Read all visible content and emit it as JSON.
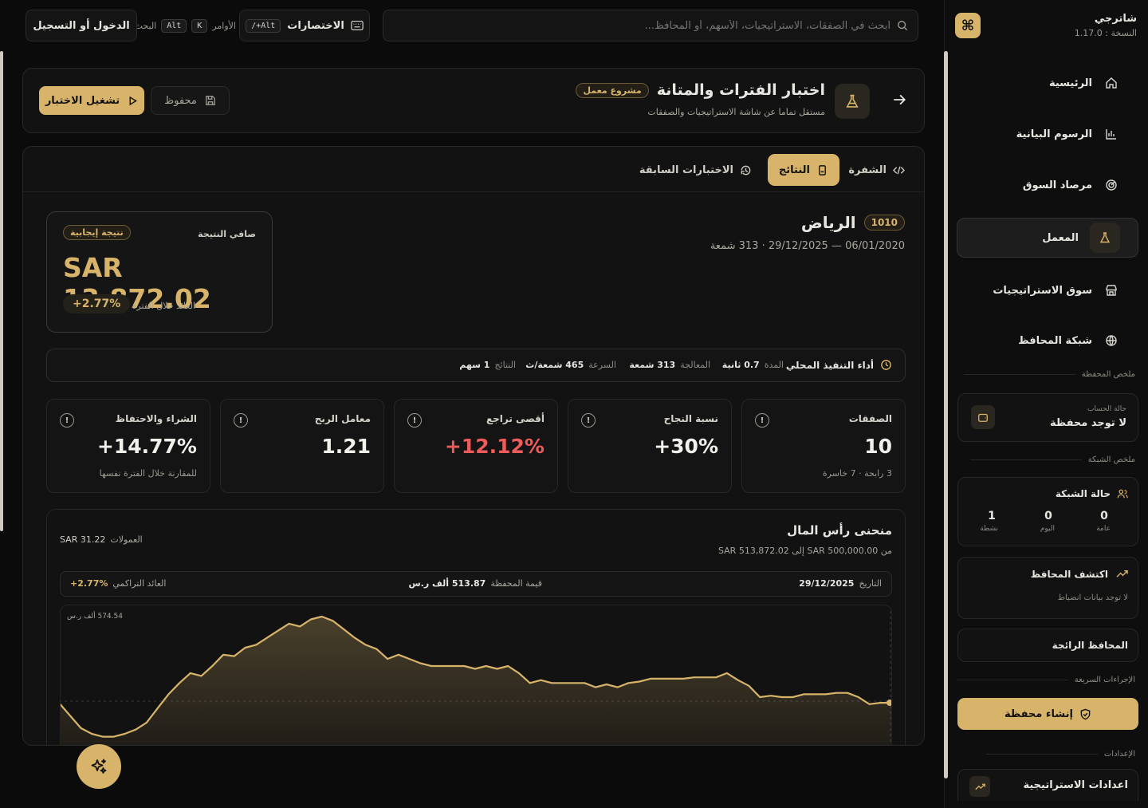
{
  "app": {
    "name": "شاترجي",
    "version": "النسخة : 1.17.0"
  },
  "header": {
    "search_placeholder": "ابحث في الصفقات، الاستراتيجيات، الأسهم، أو المحافظ...",
    "shortcuts_label": "الاختصارات",
    "shortcuts_key": "Alt+/",
    "commands_label": "الأوامر",
    "commands_key_1": "K",
    "commands_key_2": "Alt",
    "commands_trailing": "البحث",
    "login_label": "الدخول أو التسجيل"
  },
  "sidebar": {
    "items": [
      {
        "label": "الرئيسية",
        "icon": "home-icon"
      },
      {
        "label": "الرسوم البيانية",
        "icon": "chart-icon"
      },
      {
        "label": "مرصاد السوق",
        "icon": "radar-icon"
      },
      {
        "label": "المعمل",
        "icon": "flask-icon"
      },
      {
        "label": "سوق الاستراتيجيات",
        "icon": "store-icon"
      },
      {
        "label": "شبكة المحافظ",
        "icon": "globe-icon"
      }
    ],
    "portfolio_summary_label": "ملخص المحفظة",
    "account_status_label": "حالة الحساب",
    "account_status_value": "لا توجد محفظة",
    "network_summary_label": "ملخص الشبكة",
    "network_status_title": "حالة الشبكة",
    "network_stats": [
      {
        "value": "0",
        "label": "عامة"
      },
      {
        "value": "0",
        "label": "اليوم"
      },
      {
        "value": "1",
        "label": "نشطة"
      }
    ],
    "discover_title": "اكتشف المحافظ",
    "discover_sub": "لا توجد بيانات انضباط",
    "trending_title": "المحافظ الرائجة",
    "quick_actions_label": "الإجراءات السريعة",
    "create_portfolio_label": "إنشاء محفظة",
    "settings_label": "الإعدادات",
    "strategy_settings_label": "اعدادات الاستراتيجية"
  },
  "page": {
    "title": "اختبار الفترات والمتانة",
    "badge": "مشروع معمل",
    "subtitle": "مستقل تماما عن شاشة الاستراتيجيات والصفقات",
    "saved_label": "محفوظ",
    "run_label": "تشغيل الاختبار"
  },
  "tabs": {
    "code": "الشفرة",
    "results": "النتائج",
    "previous": "الاختبارات السابقة"
  },
  "result": {
    "symbol_code": "1010",
    "symbol_name": "الرياض",
    "period": "06/01/2020 — 29/12/2025 · 313 شمعة",
    "net_label": "صافي النتيجة",
    "net_badge": "نتيجة إيجابية",
    "net_value": "SAR 13,872.02",
    "period_return_label": "العائد خلال الفترة",
    "period_return_value": "+2.77%"
  },
  "perf": {
    "title": "أداء التنفيذ المحلي",
    "duration_label": "المدة",
    "duration_value": "0.7 ثانية",
    "processing_label": "المعالجة",
    "processing_value": "313 شمعة",
    "speed_label": "السرعة",
    "speed_value": "465 شمعة/ث",
    "results_label": "النتائج",
    "results_value": "1 سهم"
  },
  "stats": [
    {
      "title": "الصفقات",
      "value": "10",
      "sub": "3 رابحة · 7 خاسرة",
      "color": "#f2f0ea"
    },
    {
      "title": "نسبة النجاح",
      "value": "30%+",
      "sub": "",
      "color": "#f2f0ea"
    },
    {
      "title": "أقصى تراجع",
      "value": "12.12%+",
      "sub": "",
      "color": "#ef5b5b"
    },
    {
      "title": "معامل الربح",
      "value": "1.21",
      "sub": "",
      "color": "#f2f0ea"
    },
    {
      "title": "الشراء والاحتفاظ",
      "value": "14.77%+",
      "sub": "للمقارنة خلال الفترة نفسها",
      "color": "#f2f0ea"
    }
  ],
  "equity": {
    "title": "منحنى رأس المال",
    "subtitle": "من SAR 500,000.00 إلى SAR 513,872.02",
    "fees_label": "العمولات",
    "fees_value": "SAR 31.22",
    "date_label": "التاريخ",
    "date_value": "29/12/2025",
    "portfolio_label": "قيمة المحفظة",
    "portfolio_value": "513.87 ألف ر.س",
    "cum_label": "العائد التراكمي",
    "cum_value": "+2.77%",
    "ymax_label": "574.54 ألف ر.س"
  },
  "chart_data": {
    "type": "line",
    "title": "منحنى رأس المال",
    "series": [
      {
        "values": [
          514,
          505,
          496,
          492,
          490,
          490,
          492,
          495,
          500,
          510,
          520,
          528,
          535,
          533,
          540,
          548,
          547,
          553,
          555,
          560,
          565,
          570,
          568,
          573,
          575,
          572,
          566,
          560,
          555,
          552,
          545,
          548,
          545,
          542,
          540,
          540,
          540,
          540,
          538,
          540,
          538,
          540,
          535,
          528,
          530,
          528,
          528,
          528,
          528,
          525,
          527,
          525,
          528,
          529,
          531,
          531,
          531,
          531,
          532,
          532,
          532,
          535,
          530,
          526,
          518,
          519,
          518,
          518,
          520,
          520,
          520,
          521,
          521,
          518,
          513,
          514,
          514
        ]
      }
    ],
    "ylim": [
      470,
      575
    ]
  },
  "colors": {
    "accent": "#d7b46a",
    "negative": "#ef5b5b",
    "bg": "#0b0b0b",
    "panel": "#121212"
  }
}
